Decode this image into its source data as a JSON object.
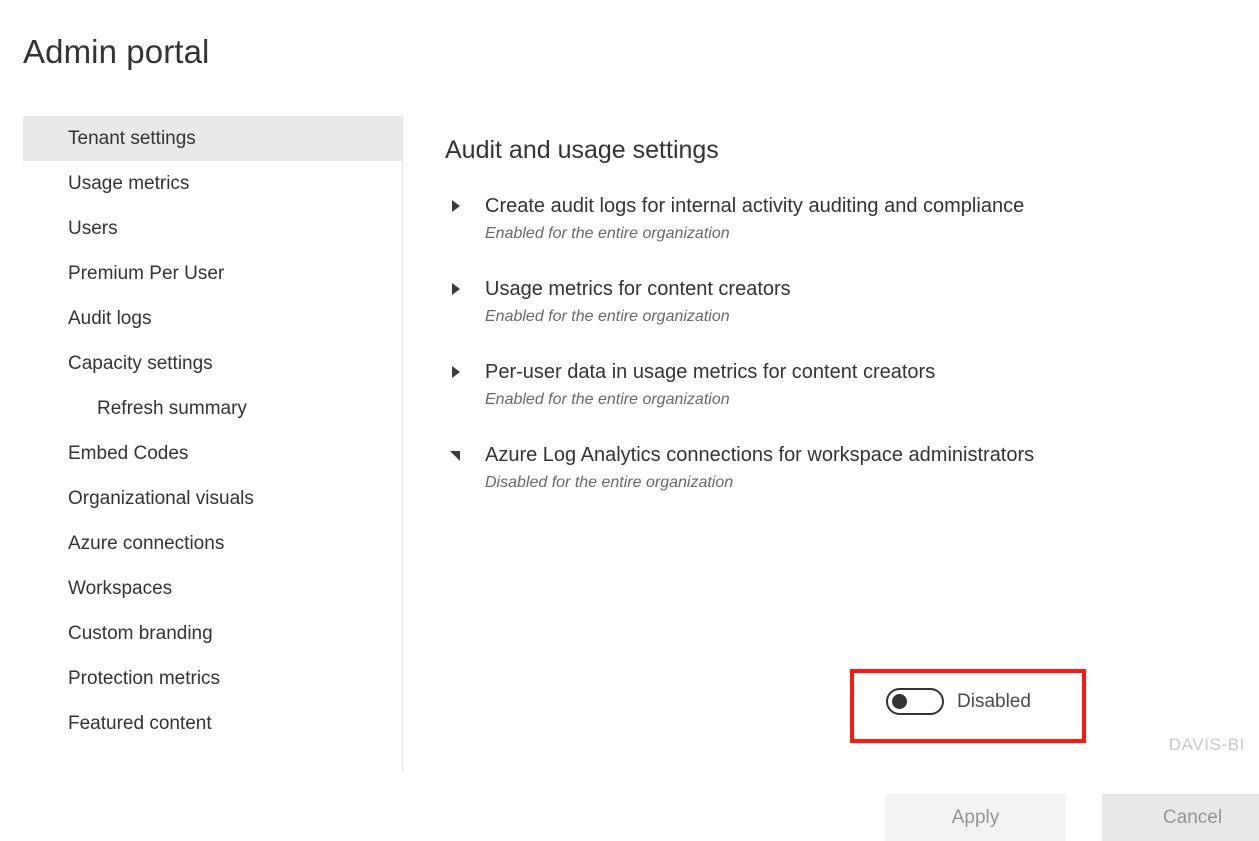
{
  "page": {
    "title": "Admin portal",
    "watermark": "DAVIS-BI"
  },
  "sidebar": {
    "items": [
      {
        "label": "Tenant settings",
        "selected": true,
        "sub": false
      },
      {
        "label": "Usage metrics",
        "selected": false,
        "sub": false
      },
      {
        "label": "Users",
        "selected": false,
        "sub": false
      },
      {
        "label": "Premium Per User",
        "selected": false,
        "sub": false
      },
      {
        "label": "Audit logs",
        "selected": false,
        "sub": false
      },
      {
        "label": "Capacity settings",
        "selected": false,
        "sub": false
      },
      {
        "label": "Refresh summary",
        "selected": false,
        "sub": true
      },
      {
        "label": "Embed Codes",
        "selected": false,
        "sub": false
      },
      {
        "label": "Organizational visuals",
        "selected": false,
        "sub": false
      },
      {
        "label": "Azure connections",
        "selected": false,
        "sub": false
      },
      {
        "label": "Workspaces",
        "selected": false,
        "sub": false
      },
      {
        "label": "Custom branding",
        "selected": false,
        "sub": false
      },
      {
        "label": "Protection metrics",
        "selected": false,
        "sub": false
      },
      {
        "label": "Featured content",
        "selected": false,
        "sub": false
      }
    ]
  },
  "main": {
    "heading": "Audit and usage settings",
    "settings": [
      {
        "title": "Create audit logs for internal activity auditing and compliance",
        "status": "Enabled for the entire organization",
        "expanded": false
      },
      {
        "title": "Usage metrics for content creators",
        "status": "Enabled for the entire organization",
        "expanded": false
      },
      {
        "title": "Per-user data in usage metrics for content creators",
        "status": "Enabled for the entire organization",
        "expanded": false
      },
      {
        "title": "Azure Log Analytics connections for workspace administrators",
        "status": "Disabled for the entire organization",
        "expanded": true
      }
    ],
    "toggle": {
      "state_label": "Disabled",
      "enabled": false,
      "highlight_color": "#fa1b0a"
    },
    "buttons": {
      "apply": "Apply",
      "cancel": "Cancel"
    }
  }
}
